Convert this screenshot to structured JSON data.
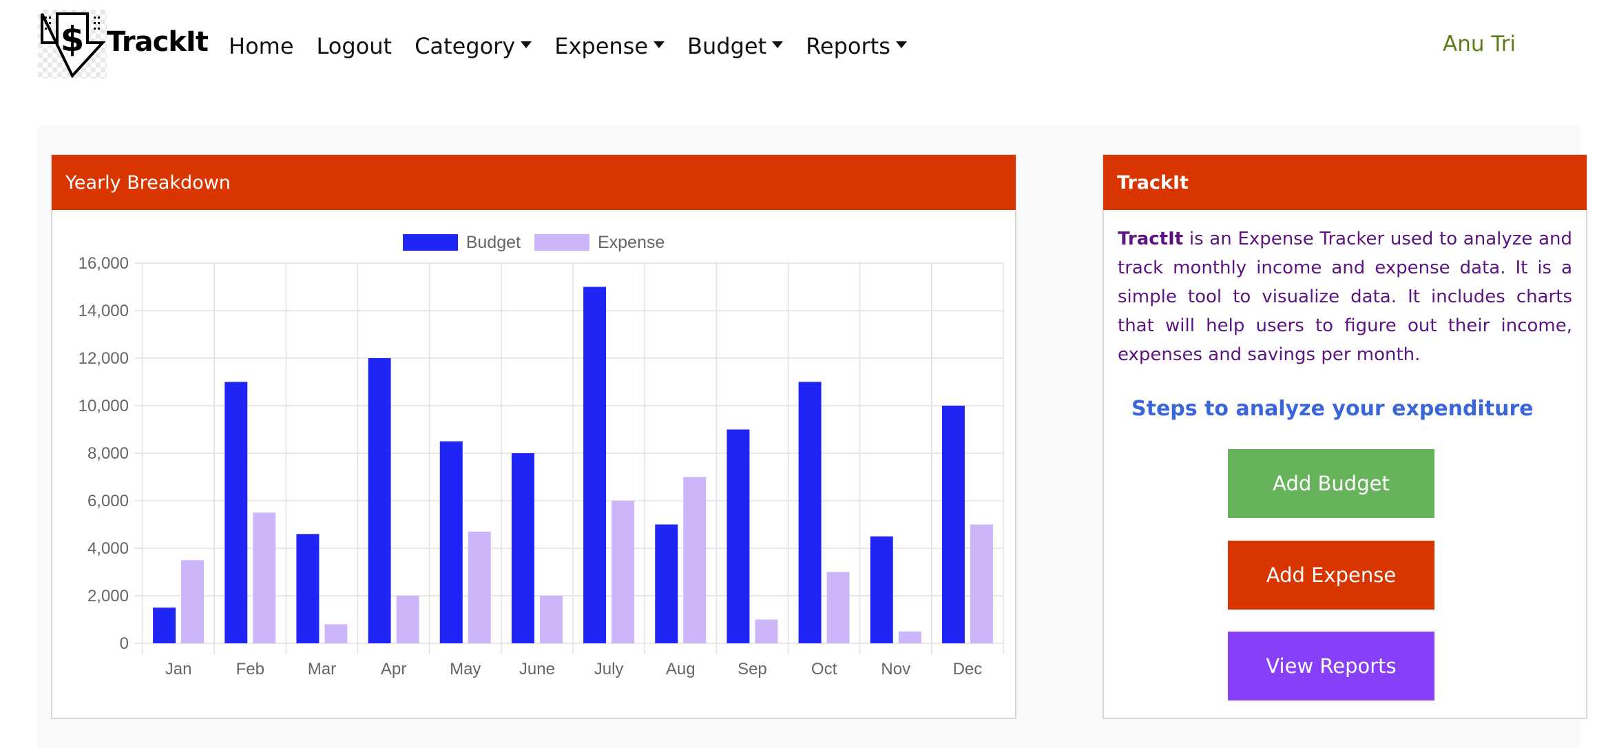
{
  "brand": {
    "name": "TrackIt",
    "logo_icon": "dollar-down-arrow-icon"
  },
  "nav": {
    "items": [
      {
        "label": "Home",
        "dropdown": false
      },
      {
        "label": "Logout",
        "dropdown": false
      },
      {
        "label": "Category",
        "dropdown": true
      },
      {
        "label": "Expense",
        "dropdown": true
      },
      {
        "label": "Budget",
        "dropdown": true
      },
      {
        "label": "Reports",
        "dropdown": true
      }
    ],
    "user_name": "Anu Tri"
  },
  "chart_card": {
    "title": "Yearly Breakdown"
  },
  "chart_data": {
    "type": "bar",
    "categories": [
      "Jan",
      "Feb",
      "Mar",
      "Apr",
      "May",
      "June",
      "July",
      "Aug",
      "Sep",
      "Oct",
      "Nov",
      "Dec"
    ],
    "series": [
      {
        "name": "Budget",
        "color": "#1f25f5",
        "values": [
          1500,
          11000,
          4600,
          12000,
          8500,
          8000,
          15000,
          5000,
          9000,
          11000,
          4500,
          10000
        ]
      },
      {
        "name": "Expense",
        "color": "#cdb5fa",
        "values": [
          3500,
          5500,
          800,
          2000,
          4700,
          2000,
          6000,
          7000,
          1000,
          3000,
          500,
          5000
        ]
      }
    ],
    "ylim": [
      0,
      16000
    ],
    "yticks": [
      "0",
      "2,000",
      "4,000",
      "6,000",
      "8,000",
      "10,000",
      "12,000",
      "14,000",
      "16,000"
    ],
    "grid": true,
    "legend": "top-center"
  },
  "info_card": {
    "title": "TrackIt",
    "intro_bold": "TractIt",
    "intro_text": " is an Expense Tracker used to analyze and track monthly income and expense data. It is a simple tool to visualize data. It includes charts that will help users to figure out their income, expenses and savings per month.",
    "steps_title": "Steps to analyze your expenditure",
    "buttons": {
      "add_budget": "Add Budget",
      "add_expense": "Add Expense",
      "view_reports": "View Reports"
    }
  },
  "colors": {
    "header_bg": "#d83501",
    "add_budget_bg": "#66b35c",
    "add_expense_bg": "#d83501",
    "view_reports_bg": "#8740f7",
    "user_name": "#5f7d1a",
    "info_text": "#5c1580",
    "steps_title": "#3a66d9"
  }
}
